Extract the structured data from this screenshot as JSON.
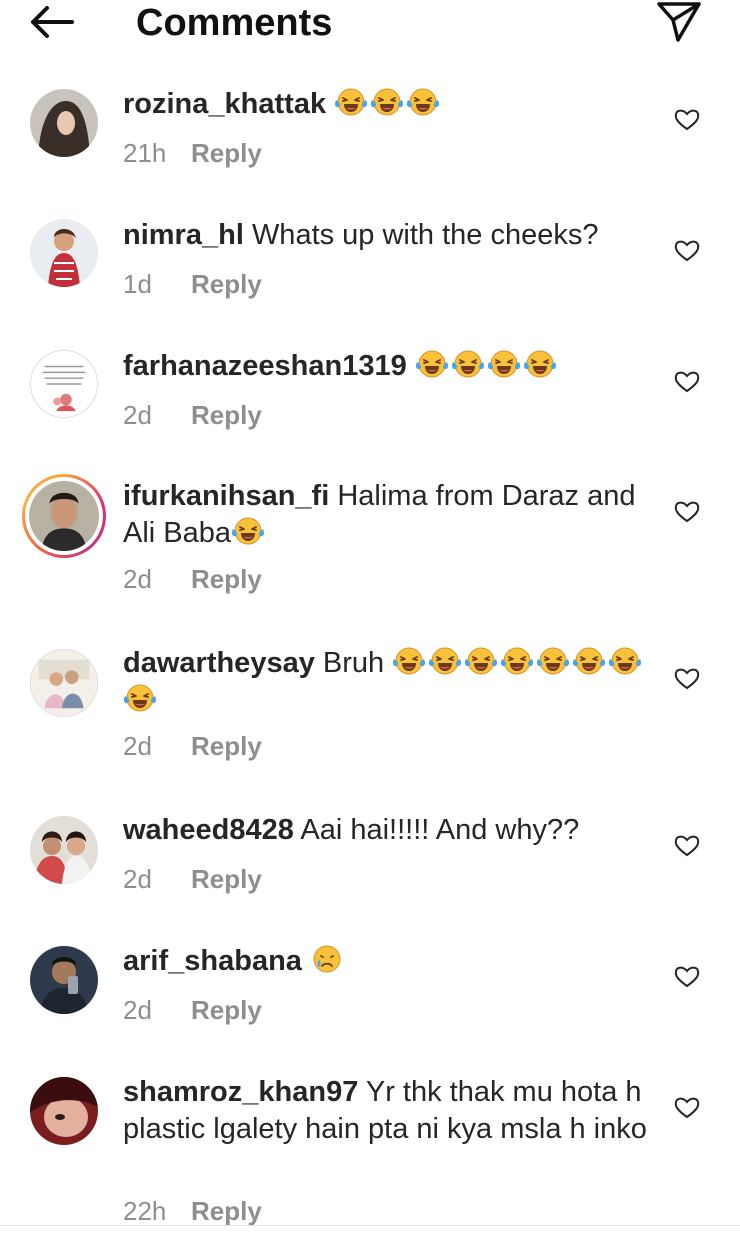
{
  "header": {
    "title": "Comments",
    "back_icon": "arrow-left-icon",
    "send_icon": "paper-plane-icon"
  },
  "reply_label": "Reply",
  "emoji_name": "face-with-tears-of-joy",
  "comments": [
    {
      "username": "rozina_khattak",
      "text": "",
      "emoji_count": 3,
      "time": "21h"
    },
    {
      "username": "nimra_hl",
      "text": "Whats up with the cheeks?",
      "emoji_count": 0,
      "time": "1d"
    },
    {
      "username": "farhanazeeshan1319",
      "text": "",
      "emoji_count": 4,
      "time": "2d"
    },
    {
      "username": "ifurkanihsan_fi",
      "text": "Halima from Daraz and Ali Baba",
      "emoji_count": 1,
      "time": "2d",
      "story_ring": true
    },
    {
      "username": "dawartheysay",
      "text": "Bruh",
      "emoji_count": 8,
      "time": "2d"
    },
    {
      "username": "waheed8428",
      "text": "Aai hai!!!!! And why??",
      "emoji_count": 0,
      "time": "2d"
    },
    {
      "username": "arif_shabana",
      "text": "",
      "emoji_count": 0,
      "sad_emoji": true,
      "time": "2d"
    },
    {
      "username": "shamroz_khan97",
      "text": "Yr thk thak mu hota h plastic lgalety hain pta ni kya msla h inko",
      "emoji_count": 0,
      "time": "22h"
    }
  ],
  "colors": {
    "text": "#262626",
    "meta": "#8e8e8e",
    "emoji": "#f7c23a",
    "tears": "#4aa3e8"
  }
}
